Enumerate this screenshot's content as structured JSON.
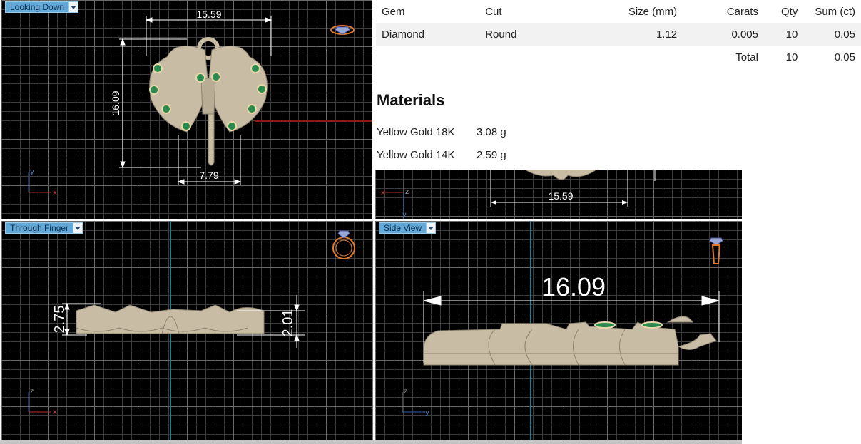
{
  "viewports": {
    "top": {
      "title": "Looking Down",
      "dims": {
        "width": "15.59",
        "height": "16.09",
        "bail_width": "7.79"
      },
      "axes": {
        "h": "x",
        "v": "y"
      }
    },
    "front": {
      "title": "Through Finger",
      "dims": {
        "total_height": "2.75",
        "body_height": "2.01"
      },
      "axes": {
        "h": "x",
        "v": "z"
      }
    },
    "side": {
      "title": "Side View",
      "dims": {
        "length": "16.09"
      },
      "axes": {
        "h": "y",
        "v": "z"
      }
    },
    "hidden": {
      "dims": {
        "width": "15.59"
      },
      "axes": {
        "h": "x",
        "v": "z",
        "extra": "y"
      }
    }
  },
  "gems": {
    "headers": {
      "gem": "Gem",
      "cut": "Cut",
      "size": "Size (mm)",
      "carats": "Carats",
      "qty": "Qty",
      "sum": "Sum (ct)"
    },
    "rows": [
      {
        "gem": "Diamond",
        "cut": "Round",
        "size": "1.12",
        "carats": "0.005",
        "qty": "10",
        "sum": "0.05"
      }
    ],
    "total": {
      "label": "Total",
      "qty": "10",
      "sum": "0.05"
    }
  },
  "materials": {
    "title": "Materials",
    "items": [
      {
        "name": "Yellow Gold 18K",
        "weight": "3.08 g"
      },
      {
        "name": "Yellow Gold 14K",
        "weight": "2.59 g"
      }
    ]
  },
  "colors": {
    "metal": "#c8bca5",
    "metal_dark": "#8d8370",
    "gem": "#2a8a4e",
    "dim": "#ffffff",
    "cyan_axis": "#1e7e8e",
    "red_axis": "#8a1a1a",
    "tab": "#62a8d8"
  }
}
